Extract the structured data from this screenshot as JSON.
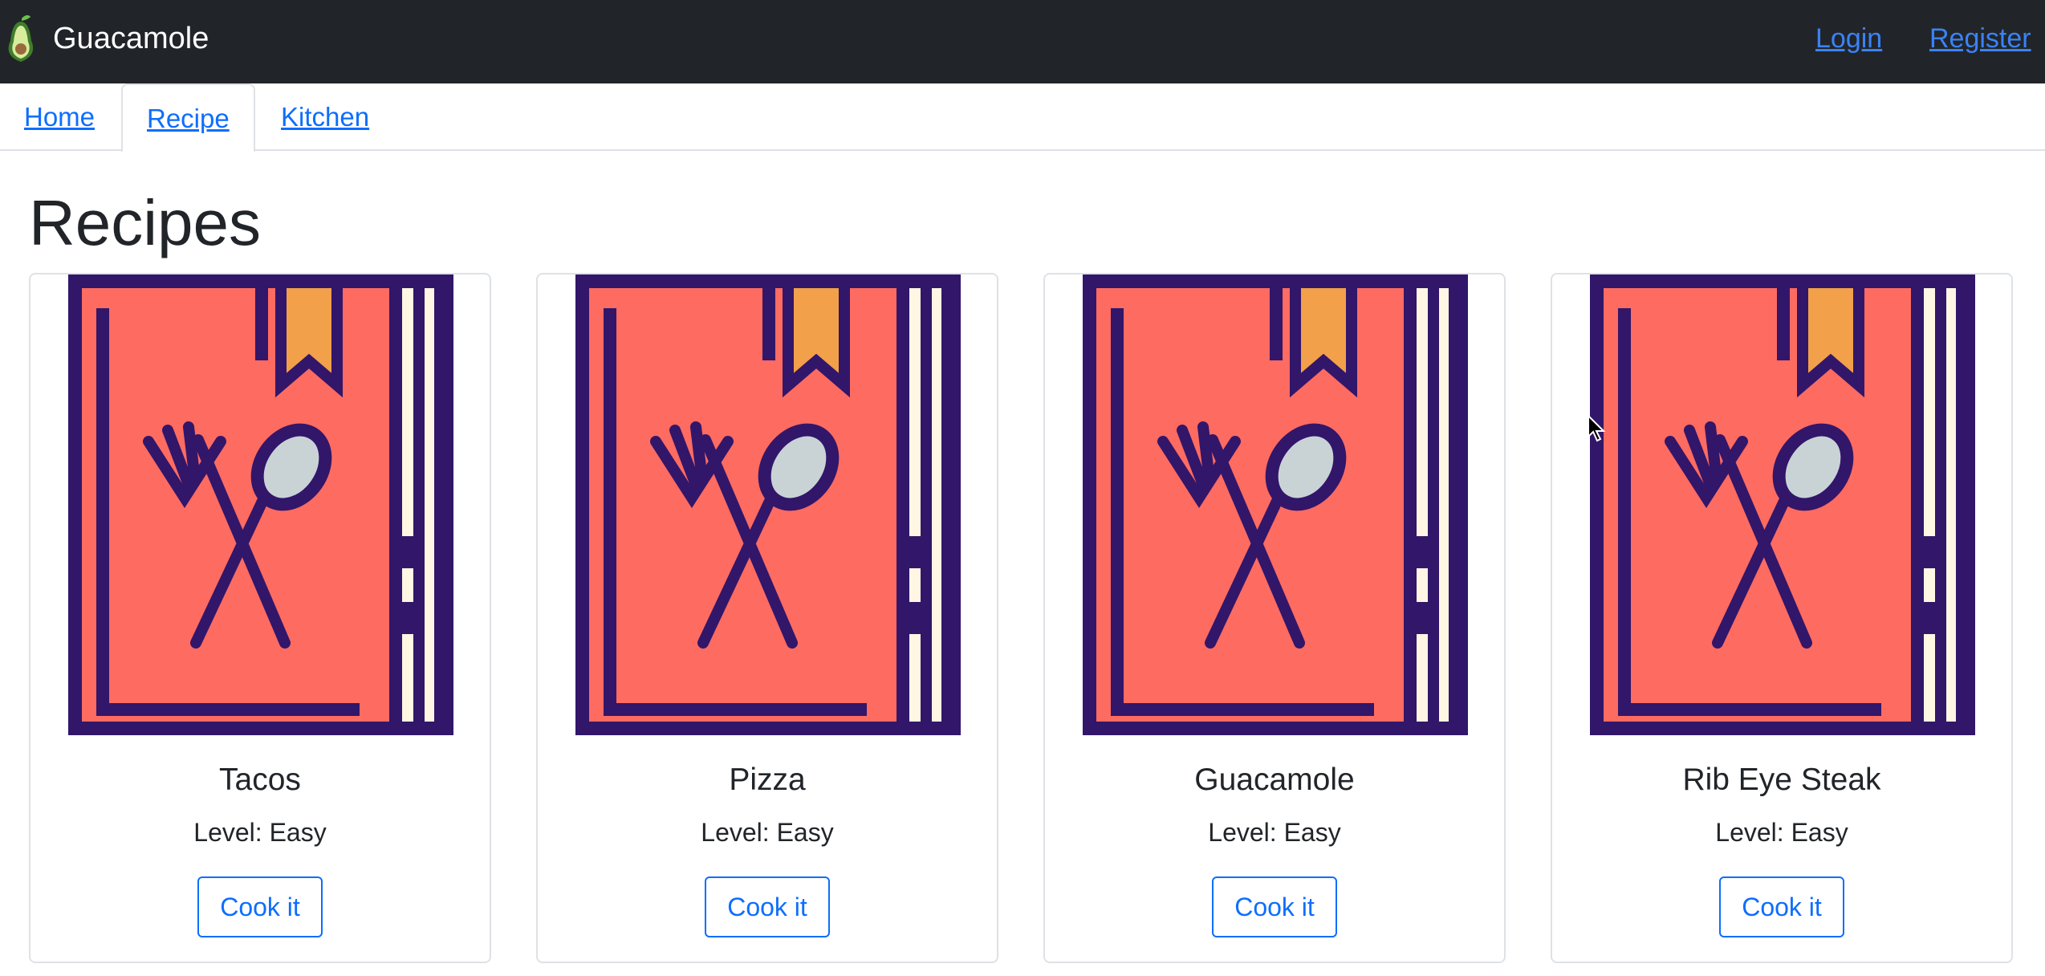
{
  "navbar": {
    "brand": "Guacamole",
    "login": "Login",
    "register": "Register"
  },
  "tabs": [
    {
      "label": "Home",
      "active": false
    },
    {
      "label": "Recipe",
      "active": true
    },
    {
      "label": "Kitchen",
      "active": false
    }
  ],
  "page": {
    "title": "Recipes"
  },
  "recipes": [
    {
      "name": "Tacos",
      "level": "Level: Easy",
      "action": "Cook it"
    },
    {
      "name": "Pizza",
      "level": "Level: Easy",
      "action": "Cook it"
    },
    {
      "name": "Guacamole",
      "level": "Level: Easy",
      "action": "Cook it"
    },
    {
      "name": "Rib Eye Steak",
      "level": "Level: Easy",
      "action": "Cook it"
    }
  ],
  "icons": {
    "brand": "avocado-icon",
    "recipe_image": "recipe-book-icon"
  },
  "colors": {
    "navbar_bg": "#212529",
    "link": "#0d6efd",
    "book_cover": "#fe6b61",
    "book_outline": "#32166a",
    "bookmark": "#f2a04a",
    "spoon_bowl": "#c9d3d6",
    "pages": "#fff6e3"
  }
}
